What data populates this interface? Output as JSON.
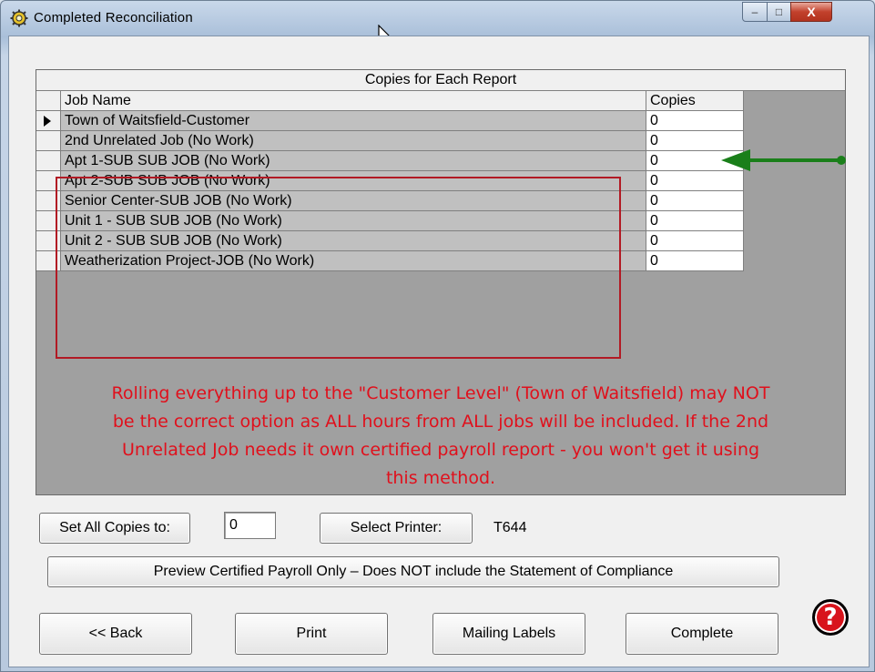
{
  "window": {
    "title": "Completed  Reconciliation",
    "controls": {
      "minimize": "–",
      "maximize": "□",
      "close": "X"
    }
  },
  "grid": {
    "caption": "Copies for Each Report",
    "columns": [
      "Job Name",
      "Copies"
    ],
    "rows": [
      {
        "name": "Town of Waitsfield-Customer",
        "copies": "0",
        "selected": true
      },
      {
        "name": "2nd Unrelated Job (No Work)",
        "copies": "0"
      },
      {
        "name": "Apt 1-SUB SUB JOB (No Work)",
        "copies": "0"
      },
      {
        "name": "Apt 2-SUB SUB JOB (No Work)",
        "copies": "0"
      },
      {
        "name": "Senior Center-SUB JOB (No Work)",
        "copies": "0"
      },
      {
        "name": "Unit 1 - SUB SUB JOB (No Work)",
        "copies": "0"
      },
      {
        "name": "Unit 2 - SUB SUB JOB (No Work)",
        "copies": "0"
      },
      {
        "name": "Weatherization Project-JOB (No Work)",
        "copies": "0"
      }
    ],
    "annotation": {
      "line1": "Rolling everything up to the \"Customer Level\" (Town of Waitsfield) may NOT",
      "line2": "be the correct option as ALL hours from ALL jobs will be included.  If the 2nd",
      "line3": "Unrelated Job needs it own certified payroll report - you won't get it using",
      "line4": "this method."
    }
  },
  "controls": {
    "set_all_label": "Set All Copies to:",
    "set_all_value": "0",
    "select_printer_label": "Select Printer:",
    "printer_name": "T644",
    "preview_label": "Preview Certified Payroll Only – Does NOT include the Statement of Compliance"
  },
  "buttons": {
    "back": "<< Back",
    "print": "Print",
    "mailing_labels": "Mailing Labels",
    "complete": "Complete",
    "help": "?"
  },
  "colors": {
    "annotation_red": "#e0101c",
    "arrow_green": "#1a7f1a",
    "highlight_box": "#b21a24"
  }
}
